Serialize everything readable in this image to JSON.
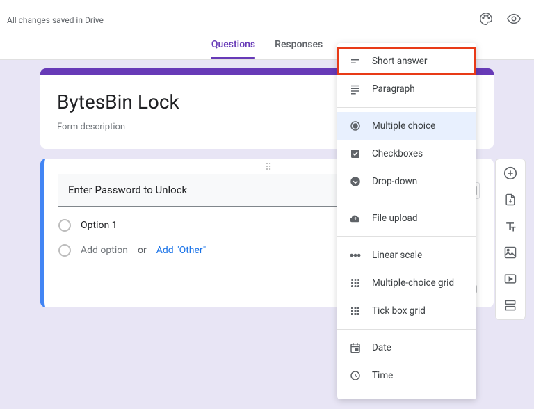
{
  "topbar": {
    "save_status": "All changes saved in Drive"
  },
  "tabs": {
    "questions": "Questions",
    "responses": "Responses"
  },
  "form": {
    "title": "BytesBin Lock",
    "description": "Form description"
  },
  "question": {
    "title": "Enter Password to Unlock",
    "option1": "Option 1",
    "add_option": "Add option",
    "or": "or",
    "add_other": "Add \"Other\""
  },
  "dropdown": {
    "short_answer": "Short answer",
    "paragraph": "Paragraph",
    "multiple_choice": "Multiple choice",
    "checkboxes": "Checkboxes",
    "drop_down": "Drop-down",
    "file_upload": "File upload",
    "linear_scale": "Linear scale",
    "mc_grid": "Multiple-choice grid",
    "tick_grid": "Tick box grid",
    "date": "Date",
    "time": "Time"
  }
}
